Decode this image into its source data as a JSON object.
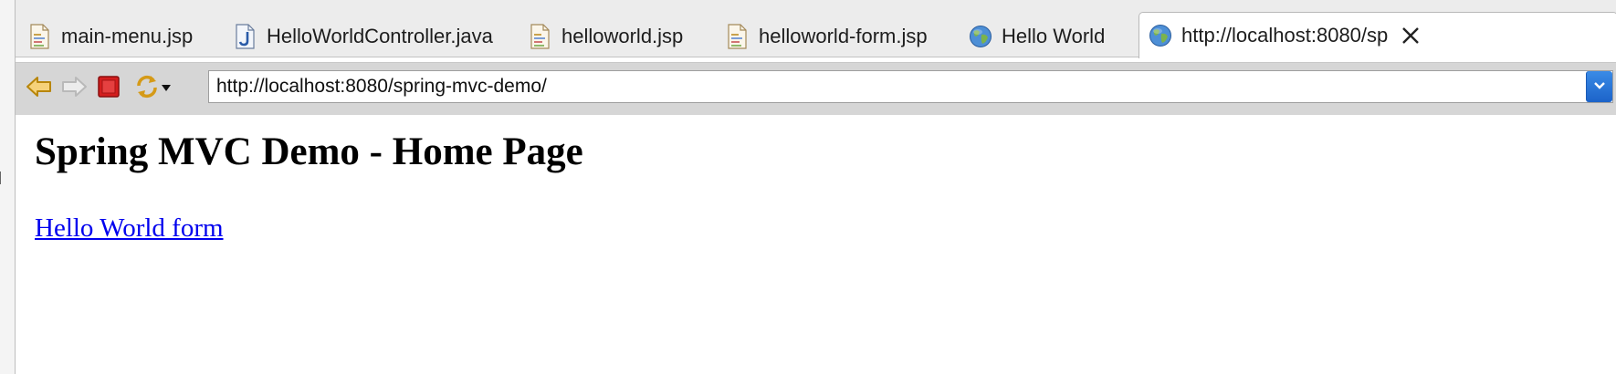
{
  "tabs": [
    {
      "label": "main-menu.jsp",
      "icon": "jsp-file-icon"
    },
    {
      "label": "HelloWorldController.java",
      "icon": "java-file-icon"
    },
    {
      "label": "helloworld.jsp",
      "icon": "jsp-file-icon"
    },
    {
      "label": "helloworld-form.jsp",
      "icon": "jsp-file-icon"
    },
    {
      "label": "Hello World",
      "icon": "globe-icon"
    },
    {
      "label": "http://localhost:8080/sp",
      "icon": "globe-icon",
      "active": true
    }
  ],
  "toolbar": {
    "url": "http://localhost:8080/spring-mvc-demo/"
  },
  "page": {
    "title": "Spring MVC Demo - Home Page",
    "link_text": "Hello World form"
  },
  "colors": {
    "link": "#0000ee",
    "toolbar_bg": "#d6d6d6",
    "tabbar_bg": "#ececec",
    "url_dropdown": "#1c63c9"
  }
}
